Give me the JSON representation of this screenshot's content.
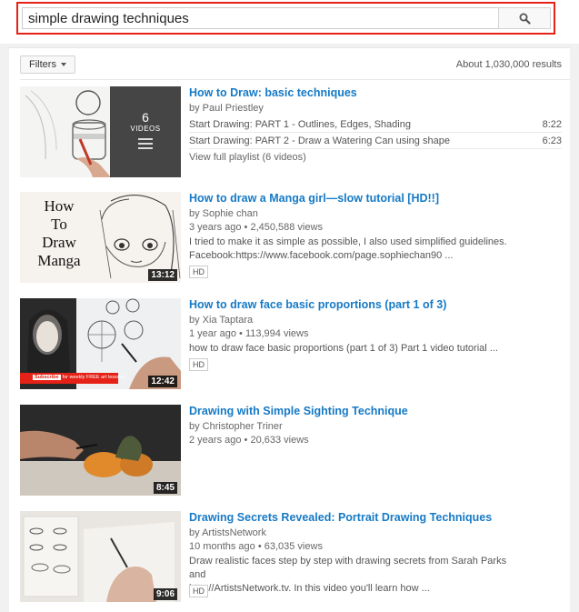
{
  "search": {
    "query": "simple drawing techniques"
  },
  "filters": {
    "label": "Filters",
    "results_count": "About 1,030,000 results"
  },
  "playlist": {
    "title": "How to Draw: basic techniques",
    "channel": "by Paul Priestley",
    "video_count": "6",
    "video_count_label": "VIDEOS",
    "items": [
      {
        "title": "Start Drawing: PART 1 - Outlines, Edges, Shading",
        "duration": "8:22"
      },
      {
        "title": "Start Drawing: PART 2 - Draw a Watering Can using shape",
        "duration": "6:23"
      }
    ],
    "view_full": "View full playlist (6 videos)"
  },
  "videos": [
    {
      "title": "How to draw a Manga girl—slow tutorial [HD!!]",
      "channel": "by Sophie chan",
      "meta": "3 years ago • 2,450,588 views",
      "desc1": "I tried to make it as simple as possible, I also used simplified guidelines.",
      "desc2": "Facebook:https://www.facebook.com/page.sophiechan90 ...",
      "badge": "HD",
      "duration": "13:12",
      "thumb_text": [
        "How",
        "To",
        "Draw",
        "Manga"
      ]
    },
    {
      "title": "How to draw face basic proportions (part 1 of 3)",
      "channel": "by Xia Taptara",
      "meta": "1 year ago • 113,994 views",
      "desc1": "how to draw face basic proportions (part 1 of 3) Part 1 video tutorial ...",
      "desc2": "",
      "badge": "HD",
      "duration": "12:42",
      "thumb_bar": "for weekly FREE art lessons"
    },
    {
      "title": "Drawing with Simple Sighting Technique",
      "channel": "by Christopher Triner",
      "meta": "2 years ago • 20,633 views",
      "desc1": "",
      "desc2": "",
      "badge": "",
      "duration": "8:45"
    },
    {
      "title": "Drawing Secrets Revealed: Portrait Drawing Techniques",
      "channel": "by ArtistsNetwork",
      "meta": "10 months ago • 63,035 views",
      "desc1": "Draw realistic faces step by step with drawing secrets from Sarah Parks and",
      "desc2": "http://ArtistsNetwork.tv. In this video you'll learn how ...",
      "badge": "HD",
      "duration": "9:06"
    }
  ]
}
